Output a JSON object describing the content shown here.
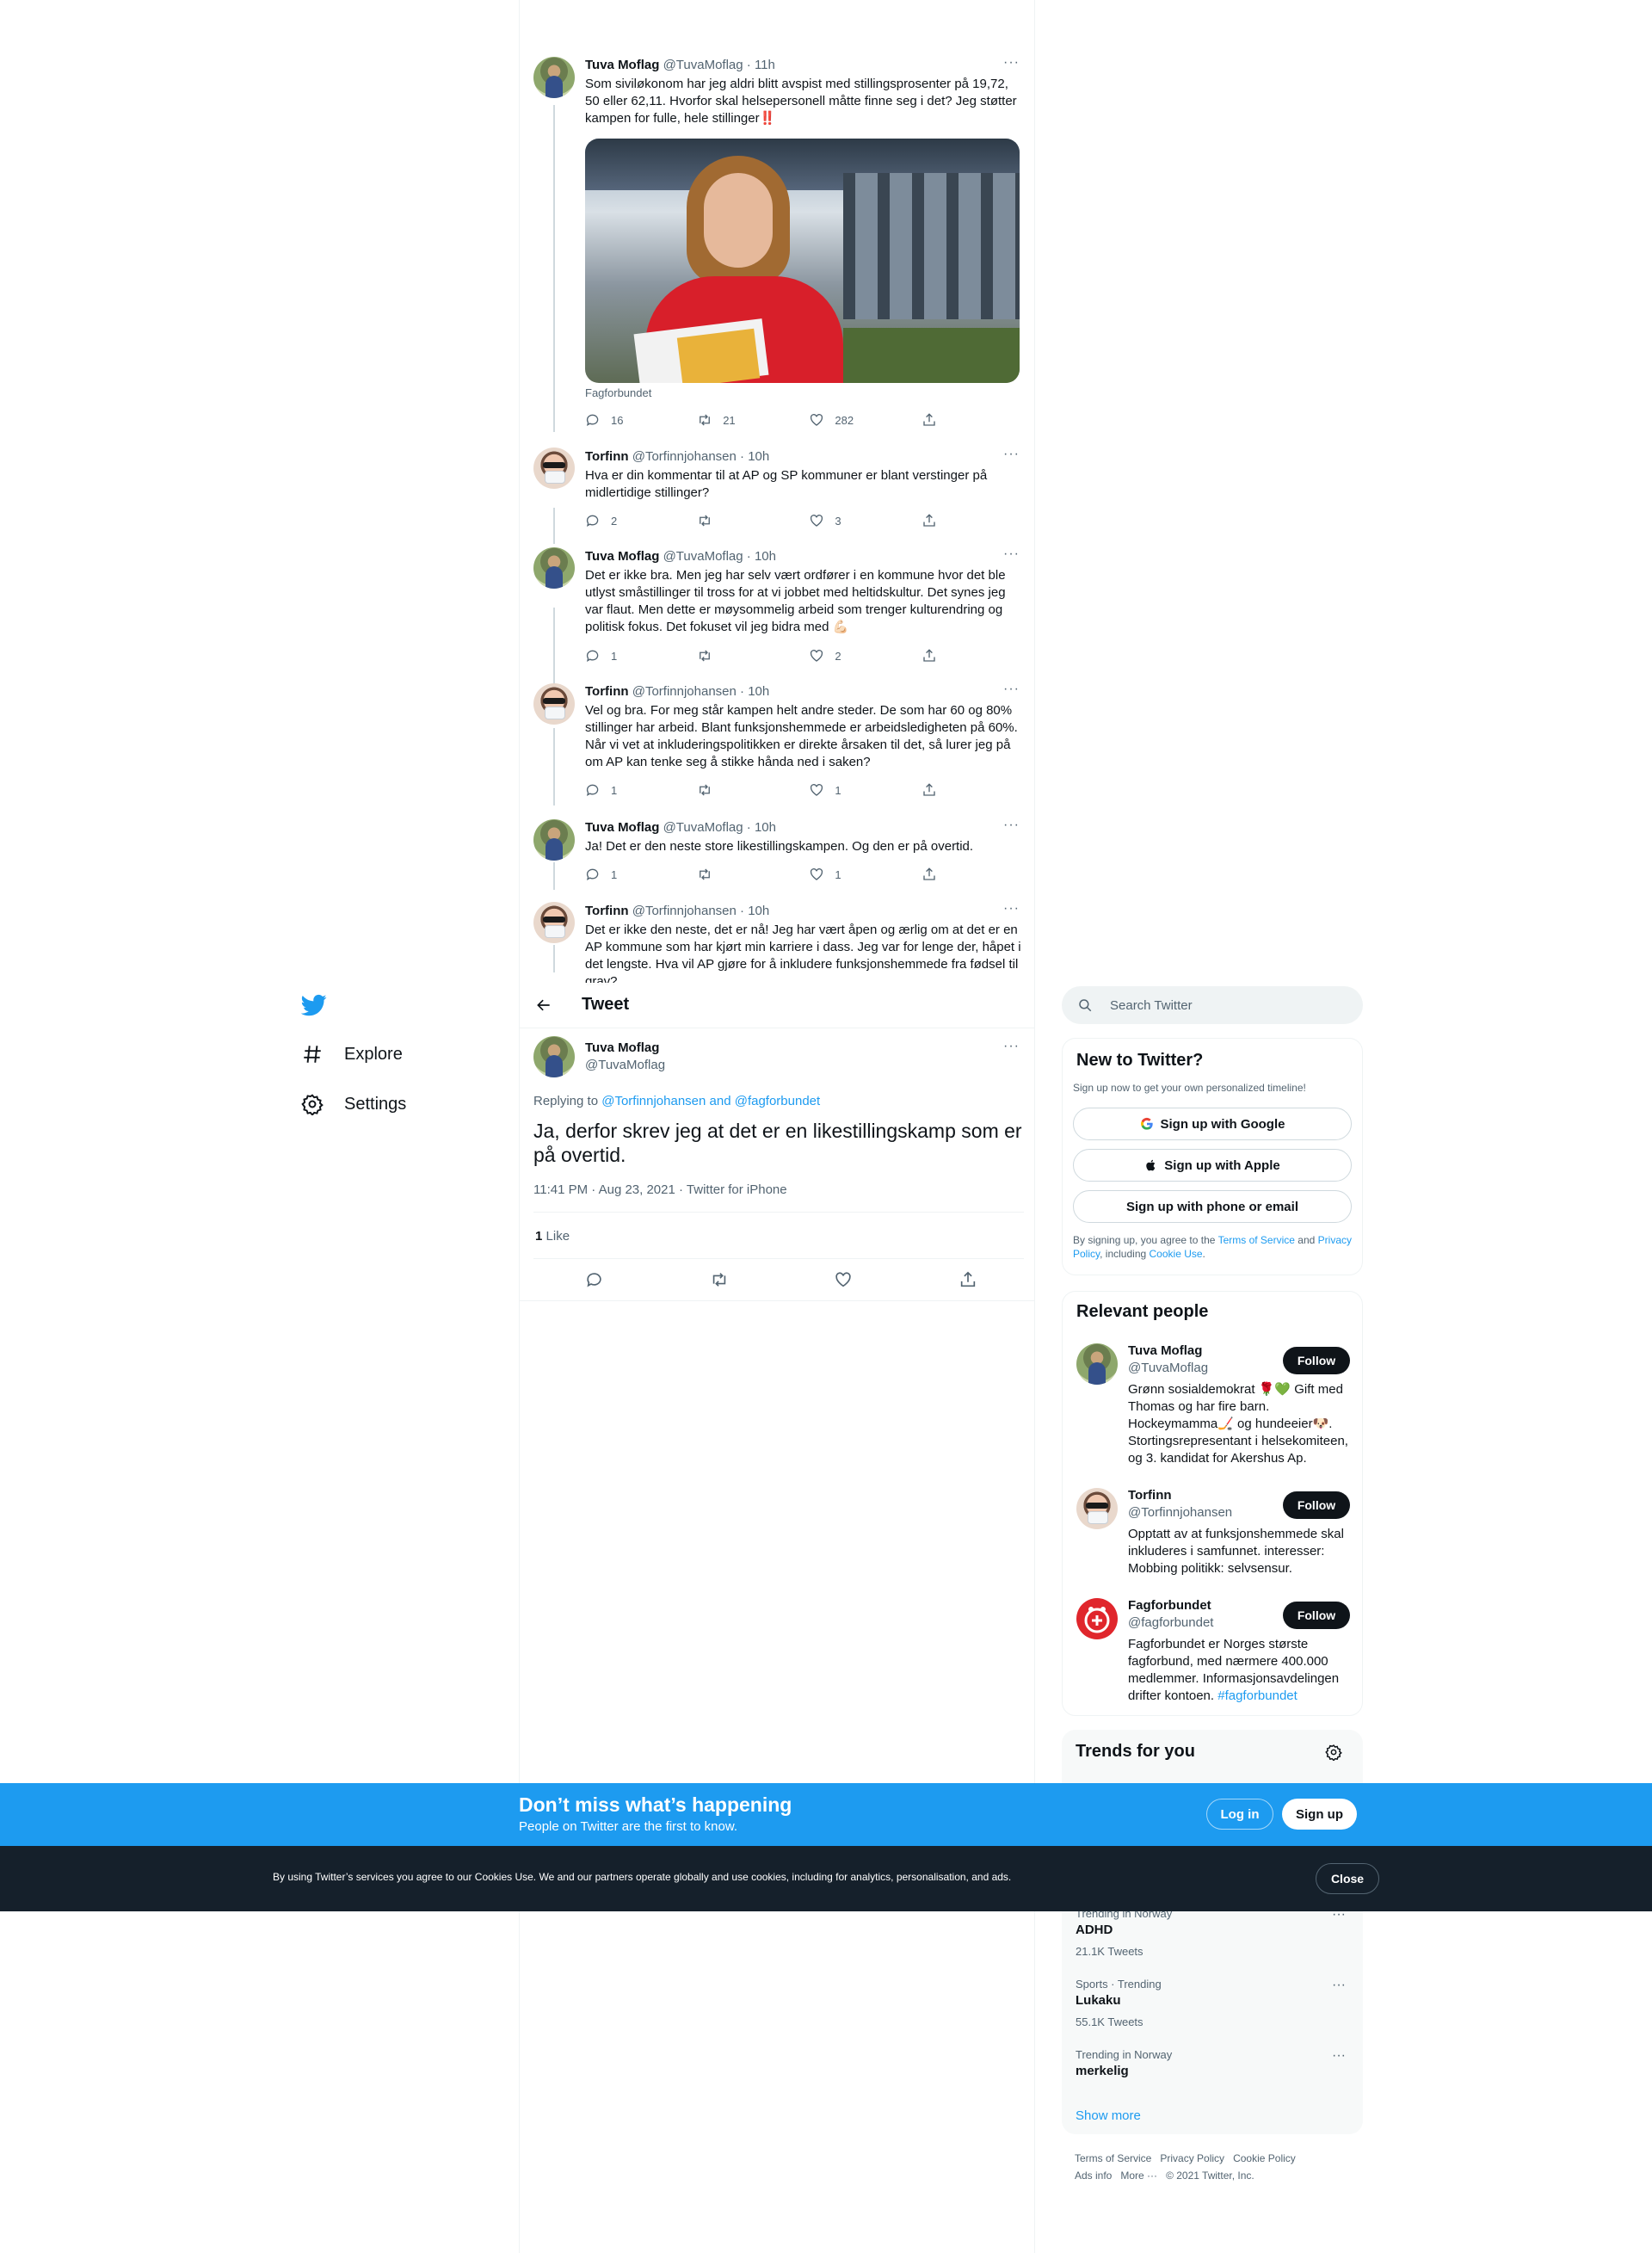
{
  "nav": {
    "explore": "Explore",
    "settings": "Settings"
  },
  "thread": [
    {
      "author": "Tuva Moflag",
      "handle": "@TuvaMoflag",
      "time": "· 11h",
      "text": "Som siviløkonom har jeg aldri blitt avspist med stillingsprosenter på 19,72, 50 eller 62,11. Hvorfor skal helsepersonell måtte finne seg i det? Jeg støtter kampen for fulle, hele stillinger‼️",
      "media_caption": "Fagforbundet",
      "replies": "16",
      "retweets": "21",
      "likes": "282"
    },
    {
      "author": "Torfinn",
      "handle": "@Torfinnjohansen",
      "time": "· 10h",
      "text": "Hva er din kommentar til at AP og SP kommuner er blant verstinger på midlertidige stillinger?",
      "replies": "2",
      "retweets": "",
      "likes": "3"
    },
    {
      "author": "Tuva Moflag",
      "handle": "@TuvaMoflag",
      "time": "· 10h",
      "text": "Det er ikke bra. Men jeg har selv vært ordfører i en kommune hvor det ble utlyst småstillinger til tross for at vi jobbet med heltidskultur. Det synes jeg var flaut. Men dette er møysommelig arbeid som trenger kulturendring og politisk fokus. Det fokuset vil jeg bidra med 💪🏻",
      "replies": "1",
      "retweets": "",
      "likes": "2"
    },
    {
      "author": "Torfinn",
      "handle": "@Torfinnjohansen",
      "time": "· 10h",
      "text": "Vel og bra. For meg står kampen helt andre steder. De som har 60 og 80% stillinger har arbeid. Blant funksjonshemmede er arbeidsledigheten på 60%. Når vi vet at inkluderingspolitikken er direkte årsaken til det, så lurer jeg på om AP kan tenke seg å stikke hånda ned i saken?",
      "replies": "1",
      "retweets": "",
      "likes": "1"
    },
    {
      "author": "Tuva Moflag",
      "handle": "@TuvaMoflag",
      "time": "· 10h",
      "text": "Ja! Det er den neste store likestillingskampen. Og den er på overtid.",
      "replies": "1",
      "retweets": "",
      "likes": "1"
    },
    {
      "author": "Torfinn",
      "handle": "@Torfinnjohansen",
      "time": "· 10h",
      "text": "Det er ikke den neste, det er nå! Jeg har vært åpen og ærlig om at det er en AP kommune som har kjørt min karriere i dass. Jeg var for lenge der, håpet i det lengste. Hva vil AP gjøre for å inkludere funksjonshemmede fra fødsel til grav?"
    }
  ],
  "header": {
    "title": "Tweet"
  },
  "main_tweet": {
    "author": "Tuva Moflag",
    "handle": "@TuvaMoflag",
    "replying_prefix": "Replying to",
    "replying_users": "@Torfinnjohansen and @fagforbundet",
    "text": "Ja, derfor skrev jeg at det er en likestillingskamp som er på overtid.",
    "meta": "11:41 PM · Aug 23, 2021 · Twitter for iPhone",
    "likes_count": "1",
    "likes_label": "Like"
  },
  "search": {
    "placeholder": "Search Twitter"
  },
  "new_to_twitter": {
    "title": "New to Twitter?",
    "subtitle": "Sign up now to get your own personalized timeline!",
    "google": "Sign up with Google",
    "apple": "Sign up with Apple",
    "phone": "Sign up with phone or email",
    "terms_prefix": "By signing up, you agree to the",
    "terms": "Terms of Service",
    "and": "and",
    "privacy": "Privacy Policy",
    "including": ", including",
    "cookie": "Cookie Use",
    "period": "."
  },
  "relevant_people": {
    "title": "Relevant people",
    "follow": "Follow",
    "people": [
      {
        "name": "Tuva Moflag",
        "handle": "@TuvaMoflag",
        "bio": "Grønn sosialdemokrat 🌹💚 Gift med Thomas og har fire barn. Hockeymamma🏒 og hundeeier🐶. Stortingsrepresentant i helsekomiteen, og 3. kandidat for Akershus Ap."
      },
      {
        "name": "Torfinn",
        "handle": "@Torfinnjohansen",
        "bio": "Opptatt av at funksjonshemmede skal inkluderes i samfunnet. interesser: Mobbing politikk: selvsensur."
      },
      {
        "name": "Fagforbundet",
        "handle": "@fagforbundet",
        "bio": "Fagforbundet er Norges største fagforbund, med nærmere 400.000 medlemmer. Informasjonsavdelingen drifter kontoen.",
        "bio_tag": "#fagforbundet"
      }
    ]
  },
  "trends": {
    "title": "Trends for you",
    "items": [
      {
        "context": "Trending in Norway",
        "name": "ADHD",
        "count": "21.1K Tweets"
      },
      {
        "context": "Sports · Trending",
        "name": "Lukaku",
        "count": "55.1K Tweets"
      },
      {
        "context": "Trending in Norway",
        "name": "merkelig",
        "count": ""
      }
    ],
    "show_more": "Show more"
  },
  "footer": {
    "terms": "Terms of Service",
    "privacy": "Privacy Policy",
    "cookie": "Cookie Policy",
    "ads": "Ads info",
    "more": "More ···",
    "copyright": "© 2021 Twitter, Inc."
  },
  "banner": {
    "title": "Don’t miss what’s happening",
    "subtitle": "People on Twitter are the first to know.",
    "login": "Log in",
    "signup": "Sign up"
  },
  "cookie_bar": {
    "text": "By using Twitter’s services you agree to our Cookies Use. We and our partners operate globally and use cookies, including for analytics, personalisation, and ads.",
    "close": "Close"
  },
  "colors": {
    "accent": "#1d9bf0",
    "text": "#0f1419",
    "muted": "#536471",
    "cookie_bg": "#15202b"
  }
}
